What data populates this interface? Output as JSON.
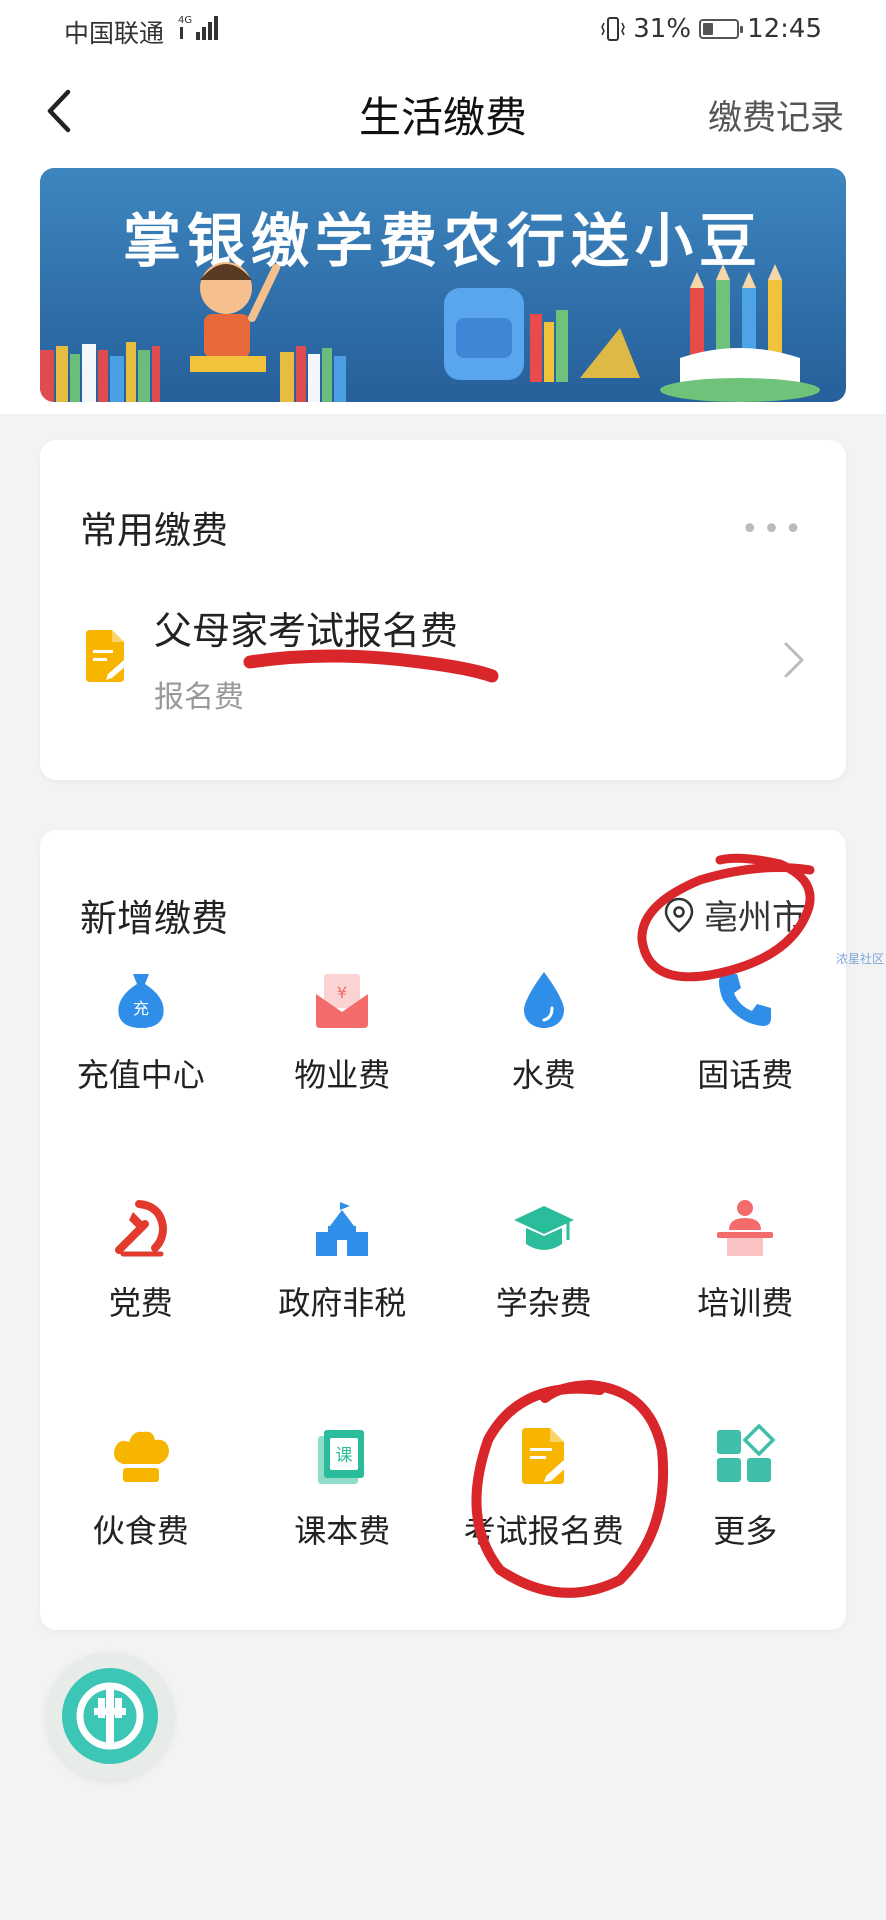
{
  "status_bar": {
    "carrier": "中国联通",
    "battery_percent": "31%",
    "time": "12:45",
    "battery_level": 0.31
  },
  "header": {
    "title": "生活缴费",
    "record_link": "缴费记录"
  },
  "banner": {
    "title": "掌银缴学费农行送小豆"
  },
  "common": {
    "title": "常用缴费",
    "item": {
      "name": "父母家考试报名费",
      "category": "报名费"
    }
  },
  "new_payments": {
    "title": "新增缴费",
    "location": "亳州市",
    "items": [
      {
        "label": "充值中心",
        "icon": "money-bag-icon",
        "color": "#2f8fe8"
      },
      {
        "label": "物业费",
        "icon": "property-envelope-icon",
        "color": "#f36b6b"
      },
      {
        "label": "水费",
        "icon": "water-drop-icon",
        "color": "#2f8fe8"
      },
      {
        "label": "固话费",
        "icon": "telephone-icon",
        "color": "#2f8fe8"
      },
      {
        "label": "党费",
        "icon": "party-emblem-icon",
        "color": "#e23b2e"
      },
      {
        "label": "政府非税",
        "icon": "government-building-icon",
        "color": "#2f8fe8"
      },
      {
        "label": "学杂费",
        "icon": "graduation-cap-icon",
        "color": "#2bbd9b"
      },
      {
        "label": "培训费",
        "icon": "lecturer-icon",
        "color": "#f36b6b"
      },
      {
        "label": "伙食费",
        "icon": "chef-hat-icon",
        "color": "#f7b500"
      },
      {
        "label": "课本费",
        "icon": "textbook-icon",
        "color": "#2bbd9b"
      },
      {
        "label": "考试报名费",
        "icon": "exam-form-icon",
        "color": "#f7b500"
      },
      {
        "label": "更多",
        "icon": "more-grid-icon",
        "color": "#3fbfaa"
      }
    ]
  },
  "watermark": "浓星社区"
}
